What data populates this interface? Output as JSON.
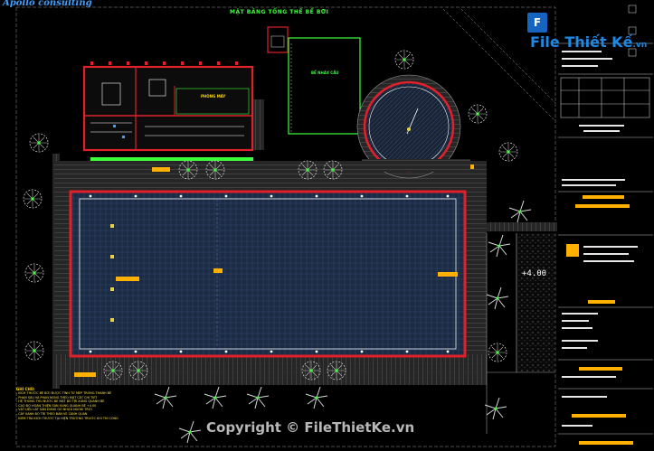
{
  "brand": "Apollo consulting",
  "title": "MẶT BẰNG TỔNG THỂ BỂ BƠI",
  "logo": {
    "mark": "F",
    "name": "File Thiết Kế",
    "domain": ".vn"
  },
  "level_mark": "+4.00",
  "copyright": "Copyright © FileThietKe.vn",
  "rooms": {
    "room_a": "PHÒNG MÁY",
    "room_b": "BỂ NHẢY CẦU"
  },
  "notes": {
    "heading": "GHI CHÚ:",
    "lines": [
      "- KÍCH THƯỚC BỂ BƠI ĐƯỢC TÍNH TỪ MÉP TRONG THÀNH BỂ",
      "- PHẦN SÂU VÀ PHẦN NÔNG THEO MẶT CẮT CHI TIẾT",
      "- HỆ THỐNG THU NƯỚC BỀ MẶT BỐ TRÍ XUNG QUANH BỂ",
      "- CAO ĐỘ HOÀN THIỆN SÀN XUNG QUANH BỂ +4.00",
      "- VẬT LIỆU LÁT SÀN DÙNG GỖ NHỰA NGOÀI TRỜI",
      "- CÂY XANH BỐ TRÍ THEO BẢN VẼ CẢNH QUAN",
      "- KIỂM TRA KÍCH THƯỚC TẠI HIỆN TRƯỜNG TRƯỚC KHI THI CÔNG"
    ]
  },
  "colors": {
    "background": "#000000",
    "pool_wall": "#e0202a",
    "water": "#1c2a40",
    "deck": "#3a3a3a",
    "accent": "#3cff3c",
    "tag": "#ffb000"
  }
}
